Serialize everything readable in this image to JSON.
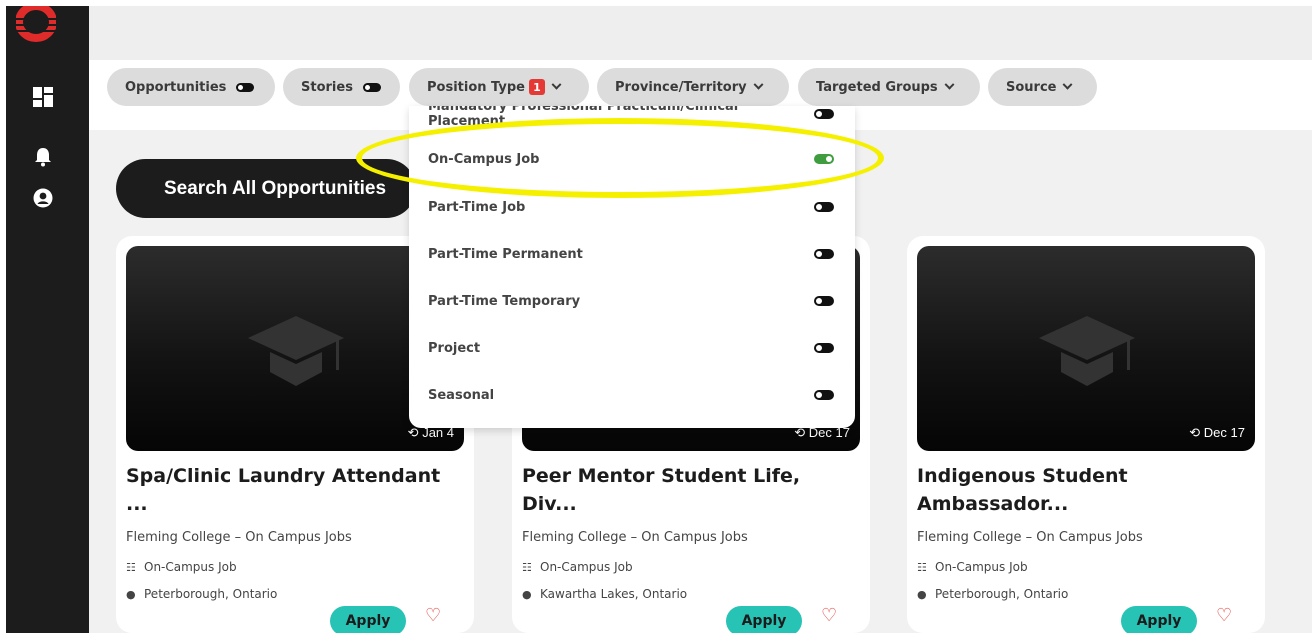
{
  "filters": {
    "opportunities": "Opportunities",
    "stories": "Stories",
    "position_type": "Position Type",
    "position_type_count": "1",
    "province": "Province/Territory",
    "targeted_groups": "Targeted Groups",
    "source": "Source"
  },
  "search_button": "Search All Opportunities",
  "dropdown": {
    "items": [
      {
        "label": "Mandatory Professional Practicum/Clinical Placement",
        "on": false
      },
      {
        "label": "On-Campus Job",
        "on": true
      },
      {
        "label": "Part-Time Job",
        "on": false
      },
      {
        "label": "Part-Time Permanent",
        "on": false
      },
      {
        "label": "Part-Time Temporary",
        "on": false
      },
      {
        "label": "Project",
        "on": false
      },
      {
        "label": "Seasonal",
        "on": false
      }
    ]
  },
  "cards": [
    {
      "date": "Jan 4",
      "title": "Spa/Clinic Laundry Attendant ...",
      "org": "Fleming College – On Campus Jobs",
      "type": "On-Campus Job",
      "location": "Peterborough, Ontario",
      "apply": "Apply"
    },
    {
      "date": "Dec 17",
      "title": "Peer Mentor Student Life, Div...",
      "org": "Fleming College – On Campus Jobs",
      "type": "On-Campus Job",
      "location": "Kawartha Lakes, Ontario",
      "apply": "Apply"
    },
    {
      "date": "Dec 17",
      "title": "Indigenous Student Ambassador...",
      "org": "Fleming College – On Campus Jobs",
      "type": "On-Campus Job",
      "location": "Peterborough, Ontario",
      "apply": "Apply"
    }
  ],
  "icons": [
    "logo-icon",
    "dashboard-icon",
    "bell-icon",
    "user-icon",
    "graduation-cap-icon",
    "history-icon",
    "people-icon",
    "location-pin-icon",
    "heart-icon"
  ],
  "colors": {
    "accent": "#27c3b5",
    "badge": "#e53935",
    "toggle_on": "#3f9d3f",
    "highlight": "#f5f000"
  }
}
